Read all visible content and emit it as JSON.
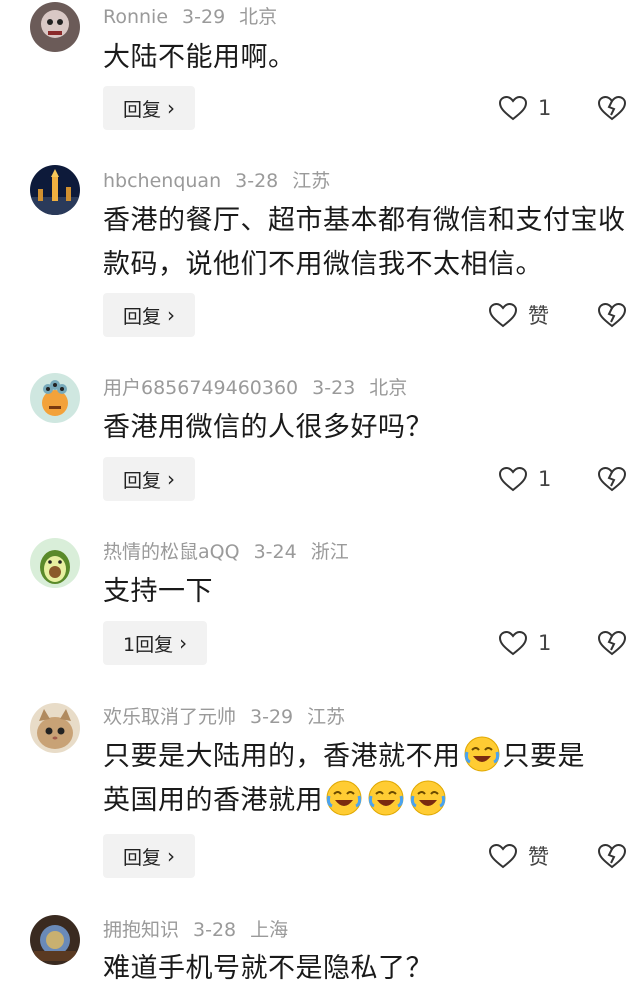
{
  "comments": [
    {
      "user": "Ronnie",
      "date": "3-29",
      "location": "北京",
      "text": "大陆不能用啊。",
      "reply_label": "回复",
      "likes": "1"
    },
    {
      "user": "hbchenquan",
      "date": "3-28",
      "location": "江苏",
      "text": "香港的餐厅、超市基本都有微信和支付宝收款码，说他们不用微信我不太相信。",
      "reply_label": "回复",
      "likes": "赞"
    },
    {
      "user": "用户6856749460360",
      "date": "3-23",
      "location": "北京",
      "text": "香港用微信的人很多好吗？",
      "reply_label": "回复",
      "likes": "1"
    },
    {
      "user": "热情的松鼠aQQ",
      "date": "3-24",
      "location": "浙江",
      "text": "支持一下",
      "reply_label": "1回复",
      "likes": "1"
    },
    {
      "user": "欢乐取消了元帅",
      "date": "3-29",
      "location": "江苏",
      "text_part1": "只要是大陆用的，香港就不用",
      "text_part2": "只要是",
      "text_line2": "英国用的香港就用",
      "reply_label": "回复",
      "likes": "赞"
    },
    {
      "user": "拥抱知识",
      "date": "3-28",
      "location": "上海",
      "text": "难道手机号就不是隐私了？"
    }
  ],
  "icons": {
    "like": "heart-icon",
    "dislike": "broken-heart-icon",
    "emoji": "laughing-crying-emoji",
    "chevron": "chevron-right-icon"
  },
  "colors": {
    "meta": "#9a9a9a",
    "reply_bg": "#f2f2f2",
    "text": "#1a1a1a"
  }
}
